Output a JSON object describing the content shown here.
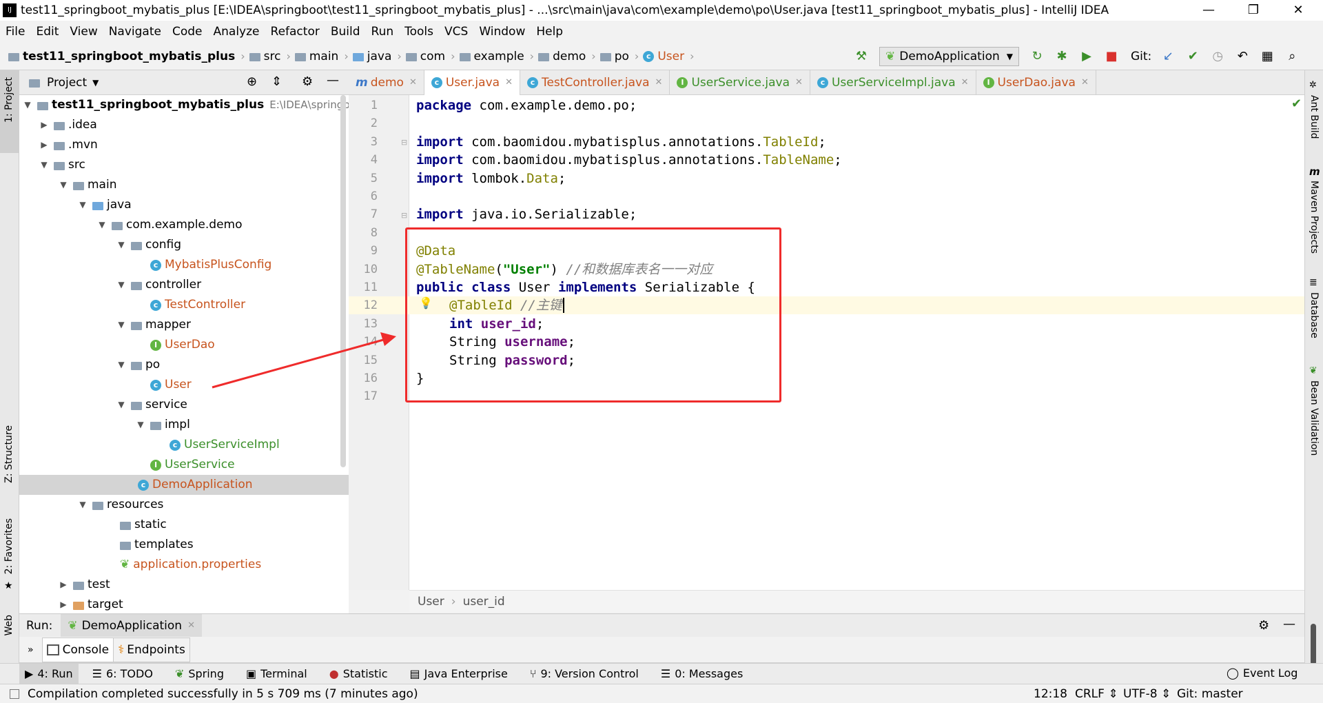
{
  "window": {
    "title": "test11_springboot_mybatis_plus [E:\\IDEA\\springboot\\test11_springboot_mybatis_plus] - ...\\src\\main\\java\\com\\example\\demo\\po\\User.java [test11_springboot_mybatis_plus] - IntelliJ IDEA",
    "minimize": "—",
    "restore": "❐",
    "close": "✕"
  },
  "menu": [
    "File",
    "Edit",
    "View",
    "Navigate",
    "Code",
    "Analyze",
    "Refactor",
    "Build",
    "Run",
    "Tools",
    "VCS",
    "Window",
    "Help"
  ],
  "nav": {
    "breadcrumbs": [
      "test11_springboot_mybatis_plus",
      "src",
      "main",
      "java",
      "com",
      "example",
      "demo",
      "po",
      "User"
    ],
    "run_config": "DemoApplication",
    "git_label": "Git:"
  },
  "project_panel": {
    "title": "Project",
    "tree": [
      {
        "label": "test11_springboot_mybatis_plus",
        "extra": "E:\\IDEA\\springboot"
      },
      {
        "label": ".idea"
      },
      {
        "label": ".mvn"
      },
      {
        "label": "src"
      },
      {
        "label": "main"
      },
      {
        "label": "java"
      },
      {
        "label": "com.example.demo"
      },
      {
        "label": "config"
      },
      {
        "label": "MybatisPlusConfig"
      },
      {
        "label": "controller"
      },
      {
        "label": "TestController"
      },
      {
        "label": "mapper"
      },
      {
        "label": "UserDao"
      },
      {
        "label": "po"
      },
      {
        "label": "User"
      },
      {
        "label": "service"
      },
      {
        "label": "impl"
      },
      {
        "label": "UserServiceImpl"
      },
      {
        "label": "UserService"
      },
      {
        "label": "DemoApplication"
      },
      {
        "label": "resources"
      },
      {
        "label": "static"
      },
      {
        "label": "templates"
      },
      {
        "label": "application.properties"
      },
      {
        "label": "test"
      },
      {
        "label": "target"
      }
    ]
  },
  "tabs": [
    "demo",
    "User.java",
    "TestController.java",
    "UserService.java",
    "UserServiceImpl.java",
    "UserDao.java"
  ],
  "editor": {
    "line_numbers": [
      "1",
      "2",
      "3",
      "4",
      "5",
      "6",
      "7",
      "8",
      "9",
      "10",
      "11",
      "12",
      "13",
      "14",
      "15",
      "16",
      "17"
    ],
    "lines": {
      "l1_kw": "package",
      "l1_rest": " com.example.demo.po;",
      "l3_kw": "import",
      "l3_rest": " com.baomidou.mybatisplus.annotations.",
      "l3_cls": "TableId",
      "l3_end": ";",
      "l4_kw": "import",
      "l4_rest": " com.baomidou.mybatisplus.annotations.",
      "l4_cls": "TableName",
      "l4_end": ";",
      "l5_kw": "import",
      "l5_rest": " lombok.",
      "l5_cls": "Data",
      "l5_end": ";",
      "l7_kw": "import",
      "l7_rest": " java.io.Serializable;",
      "l9_ann": "@Data",
      "l10_ann": "@TableName",
      "l10_p1": "(",
      "l10_str": "\"User\"",
      "l10_p2": ") ",
      "l10_cmt": "//和数据库表名一一对应",
      "l11_kw1": "public",
      "l11_kw2": "class",
      "l11_name": " User ",
      "l11_kw3": "implements",
      "l11_rest": " Serializable {",
      "l12_ann": "@TableId",
      "l12_cmt": " //主键",
      "l13_kw": "int",
      "l13_fld": "user_id",
      "l13_end": ";",
      "l14_type": "String ",
      "l14_fld": "username",
      "l14_end": ";",
      "l15_type": "String ",
      "l15_fld": "password",
      "l15_end": ";",
      "l16": "}"
    },
    "breadcrumb": [
      "User",
      "user_id"
    ]
  },
  "run_panel": {
    "label": "Run:",
    "config": "DemoApplication",
    "tabs": [
      "Console",
      "Endpoints"
    ]
  },
  "tool_windows": [
    "4: Run",
    "6: TODO",
    "Spring",
    "Terminal",
    "Statistic",
    "Java Enterprise",
    "9: Version Control",
    "0: Messages",
    "Event Log"
  ],
  "side_tools": {
    "left": [
      "1: Project",
      "Z: Structure",
      "2: Favorites",
      "Web"
    ],
    "right": [
      "Ant Build",
      "Maven Projects",
      "Database",
      "Bean Validation"
    ]
  },
  "status": {
    "message": "Compilation completed successfully in 5 s 709 ms (7 minutes ago)",
    "position": "12:18",
    "line_sep": "CRLF",
    "encoding": "UTF-8",
    "git": "Git: master"
  },
  "colors": {
    "accent": "#3ea7d6",
    "highlight_box": "#ef2b2b",
    "keyword": "#000080",
    "annotation": "#808000"
  }
}
